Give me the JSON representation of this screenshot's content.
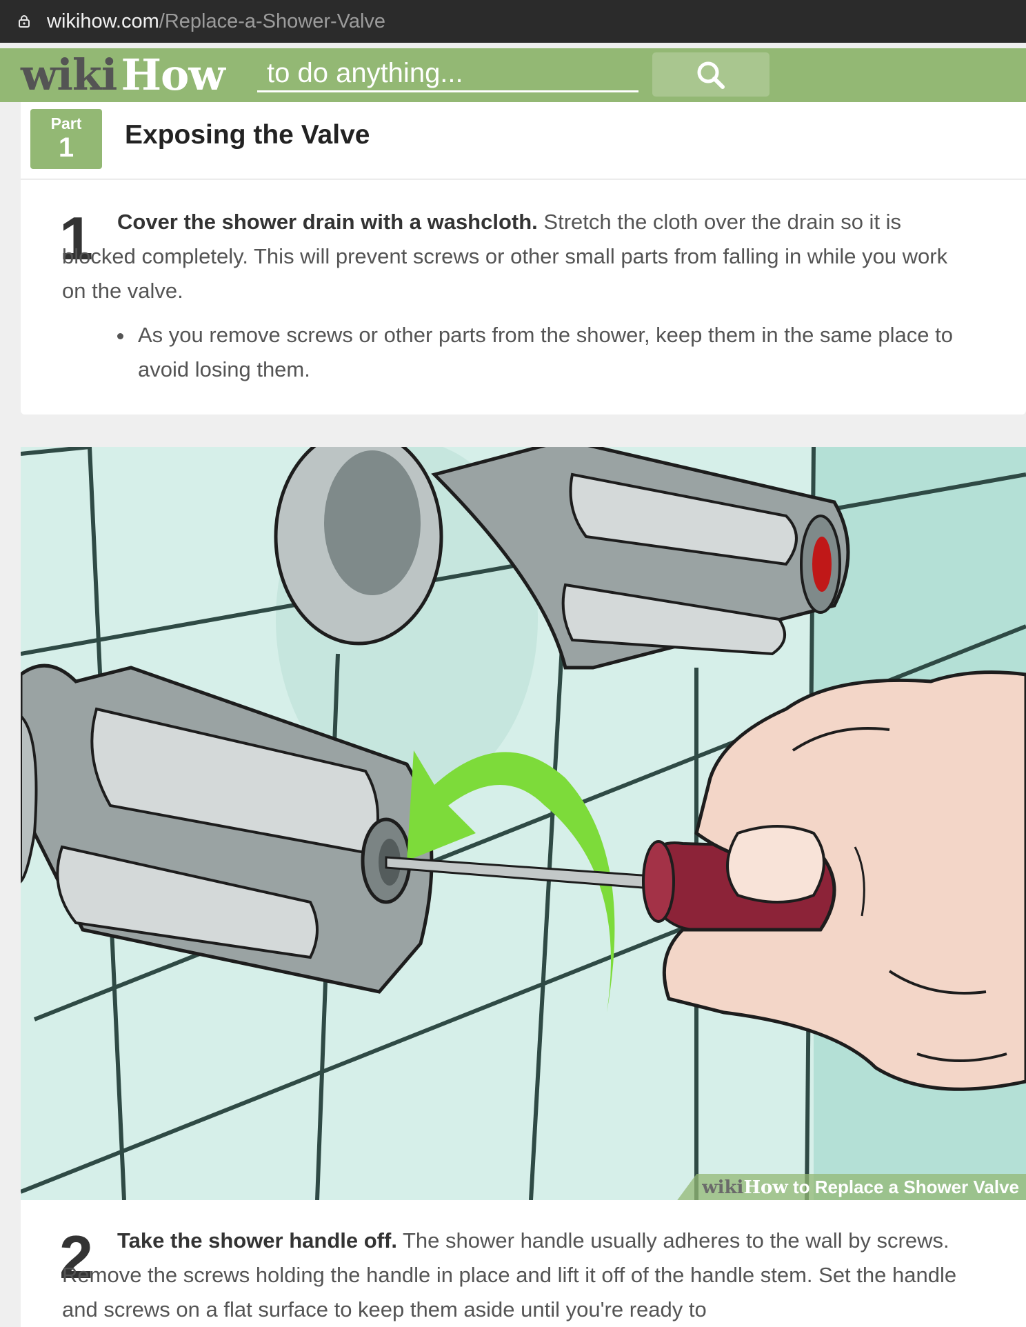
{
  "browser": {
    "url_host": "wikihow.com",
    "url_path": "/Replace-a-Shower-Valve",
    "lock_icon": "lock-icon"
  },
  "header": {
    "logo_wiki": "wiki",
    "logo_how": "How",
    "search_placeholder": "to do anything...",
    "search_icon": "search-icon",
    "brand_color": "#93b874"
  },
  "part": {
    "label": "Part",
    "number": "1",
    "title": "Exposing the Valve"
  },
  "steps": [
    {
      "number": "1",
      "bold": "Cover the shower drain with a washcloth.",
      "text": " Stretch the cloth over the drain so it is blocked completely. This will prevent screws or other small parts from falling in while you work on the valve.",
      "bullets": [
        "As you remove screws or other parts from the shower, keep them in the same place to avoid losing them."
      ]
    },
    {
      "number": "2",
      "bold": "Take the shower handle off.",
      "text": " The shower handle usually adheres to the wall by screws. Remove the screws holding the handle in place and lift it off of the handle stem. Set the handle and screws on a flat surface to keep them aside until you're ready to"
    }
  ],
  "image": {
    "watermark_wiki": "wiki",
    "watermark_how": "How",
    "watermark_text": " to Replace a Shower Valve"
  }
}
